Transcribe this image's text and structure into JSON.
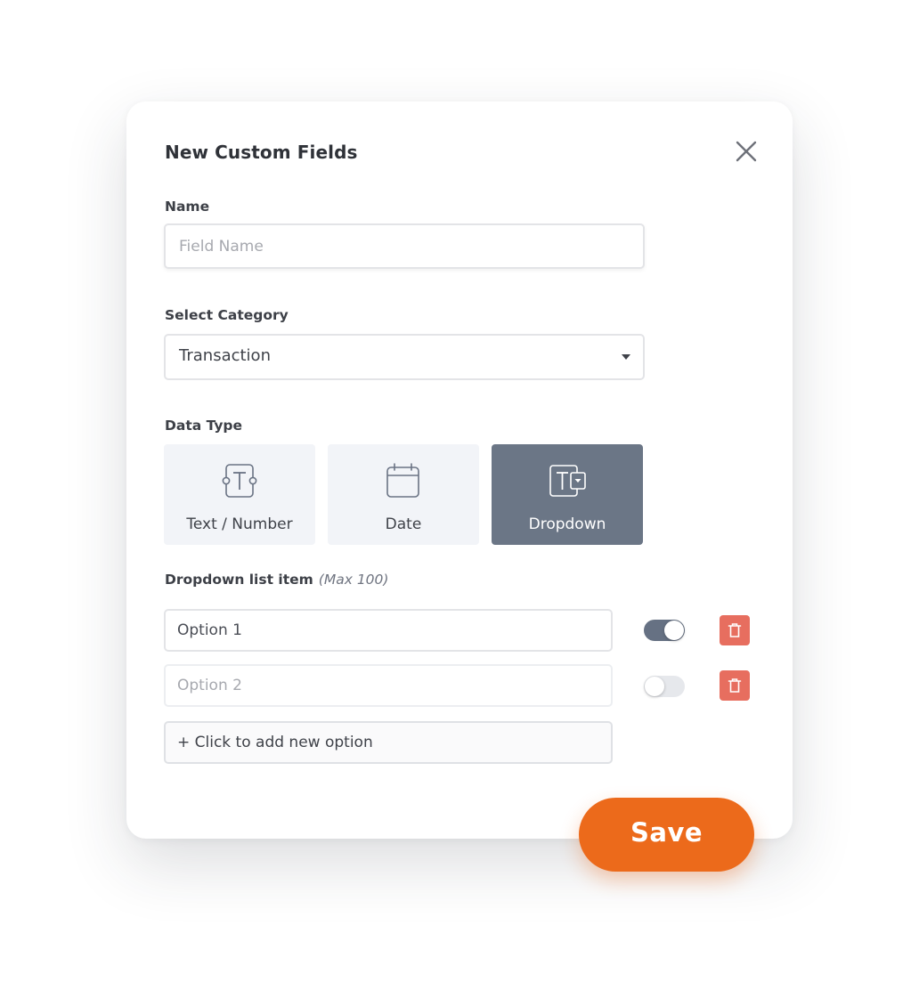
{
  "dialog": {
    "title": "New Custom Fields"
  },
  "name_field": {
    "label": "Name",
    "placeholder": "Field Name",
    "value": ""
  },
  "category_field": {
    "label": "Select Category",
    "selected": "Transaction"
  },
  "data_type": {
    "label": "Data Type",
    "options": [
      {
        "label": "Text / Number",
        "icon": "text-field-icon",
        "selected": false
      },
      {
        "label": "Date",
        "icon": "calendar-icon",
        "selected": false
      },
      {
        "label": "Dropdown",
        "icon": "dropdown-field-icon",
        "selected": true
      }
    ]
  },
  "dropdown_list": {
    "label": "Dropdown list item",
    "hint": "(Max 100)",
    "items": [
      {
        "value": "Option 1",
        "placeholder": "",
        "enabled": true
      },
      {
        "value": "",
        "placeholder": "Option 2",
        "enabled": false
      }
    ],
    "add_label": "+ Click to add new option"
  },
  "actions": {
    "save_label": "Save"
  },
  "colors": {
    "accent": "#ec6a1b",
    "selected_card": "#6b7686",
    "delete": "#e76e5f",
    "toggle_on": "#667183"
  }
}
